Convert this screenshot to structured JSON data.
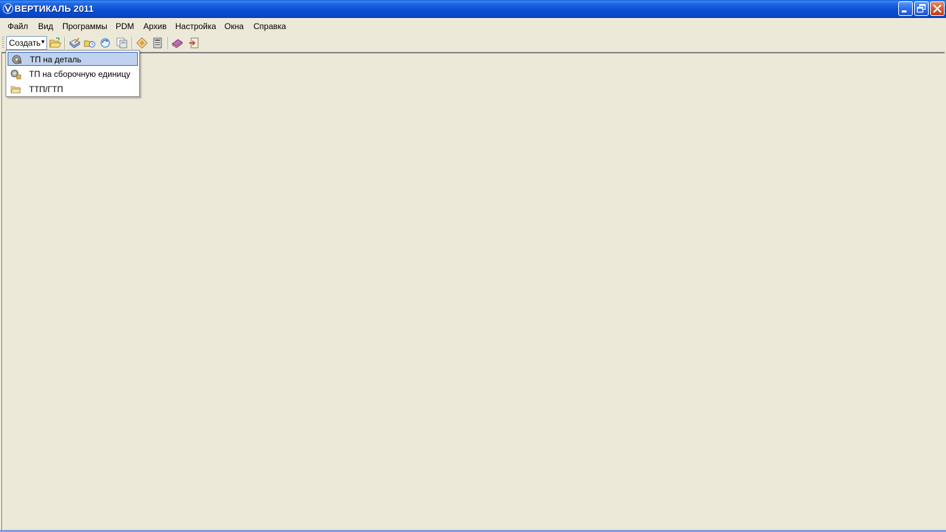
{
  "window": {
    "title": "ВЕРТИКАЛЬ 2011",
    "logo_icon": "vertical-logo-icon",
    "controls": [
      "minimize-icon",
      "restore-icon",
      "close-icon"
    ]
  },
  "menu": {
    "items": [
      "Файл",
      "Вид",
      "Программы",
      "PDM",
      "Архив",
      "Настройка",
      "Окна",
      "Справка"
    ]
  },
  "toolbar": {
    "create_label": "Создать",
    "icons": [
      "open-folder-icon",
      "edit-document-icon",
      "open-archive-icon",
      "refresh-icon",
      "save-icon",
      "diamond-icon",
      "book-icon",
      "notebook-icon",
      "exit-icon"
    ]
  },
  "dropdown": {
    "items": [
      {
        "label": "ТП на деталь",
        "icon": "part-icon",
        "selected": true
      },
      {
        "label": "ТП на сборочную единицу",
        "icon": "assembly-icon",
        "selected": false
      },
      {
        "label": "ТТП/ГТП",
        "icon": "folder-icon",
        "selected": false
      }
    ]
  },
  "colors": {
    "titlebar": "#0a4fd6",
    "background": "#ece9d8",
    "selection": "#c1d2ee",
    "selection_border": "#316ac5"
  }
}
